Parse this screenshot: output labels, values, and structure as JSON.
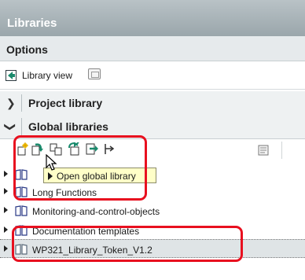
{
  "window": {
    "title": "Libraries"
  },
  "options": {
    "title": "Options"
  },
  "library_view": {
    "label": "Library view",
    "icon": "library-view-icon"
  },
  "sections": {
    "project_library": {
      "label": "Project library",
      "expanded": false
    },
    "global_libraries": {
      "label": "Global libraries",
      "expanded": true
    }
  },
  "toolbar": {
    "buttons": [
      {
        "name": "new-global-library-button",
        "icon": "new-library-icon"
      },
      {
        "name": "open-global-library-button",
        "icon": "open-library-icon"
      },
      {
        "name": "copy-library-button",
        "icon": "copy-icon"
      },
      {
        "name": "update-library-button",
        "icon": "update-icon"
      },
      {
        "name": "export-library-button",
        "icon": "export-icon"
      },
      {
        "name": "close-library-button",
        "icon": "close-library-icon"
      }
    ],
    "tooltip": "Open global library"
  },
  "tree": {
    "items": [
      {
        "label": ""
      },
      {
        "label": "Long Functions"
      },
      {
        "label": "Monitoring-and-control-objects"
      },
      {
        "label": "Documentation templates"
      },
      {
        "label": "WP321_Library_Token_V1.2"
      }
    ]
  },
  "colors": {
    "accent": "#198a6c",
    "highlight": "#e8101f",
    "tooltip_bg": "#ffffc8"
  }
}
